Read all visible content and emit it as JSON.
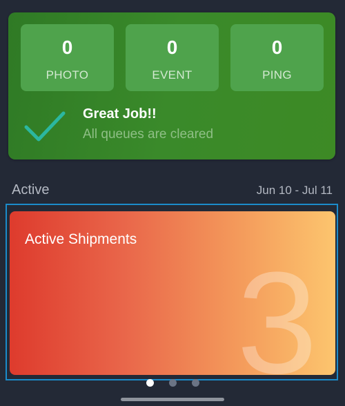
{
  "queues": [
    {
      "count": "0",
      "label": "PHOTO"
    },
    {
      "count": "0",
      "label": "EVENT"
    },
    {
      "count": "0",
      "label": "PING"
    }
  ],
  "status": {
    "title": "Great Job!!",
    "subtitle": "All queues are cleared",
    "icon": "checkmark-icon"
  },
  "section": {
    "title": "Active",
    "date_range": "Jun 10 - Jul 11"
  },
  "shipments": {
    "title": "Active Shipments",
    "count": "3"
  },
  "carousel": {
    "page_count": 3,
    "active_page": 1
  },
  "colors": {
    "background": "#232936",
    "queue_card": "#3a8a2a",
    "tile": "#4fa34c",
    "check": "#2bb7a0",
    "shipment_gradient_start": "#de3b2d",
    "shipment_gradient_end": "#fcc56e",
    "focus_border": "#1b8ccb"
  }
}
